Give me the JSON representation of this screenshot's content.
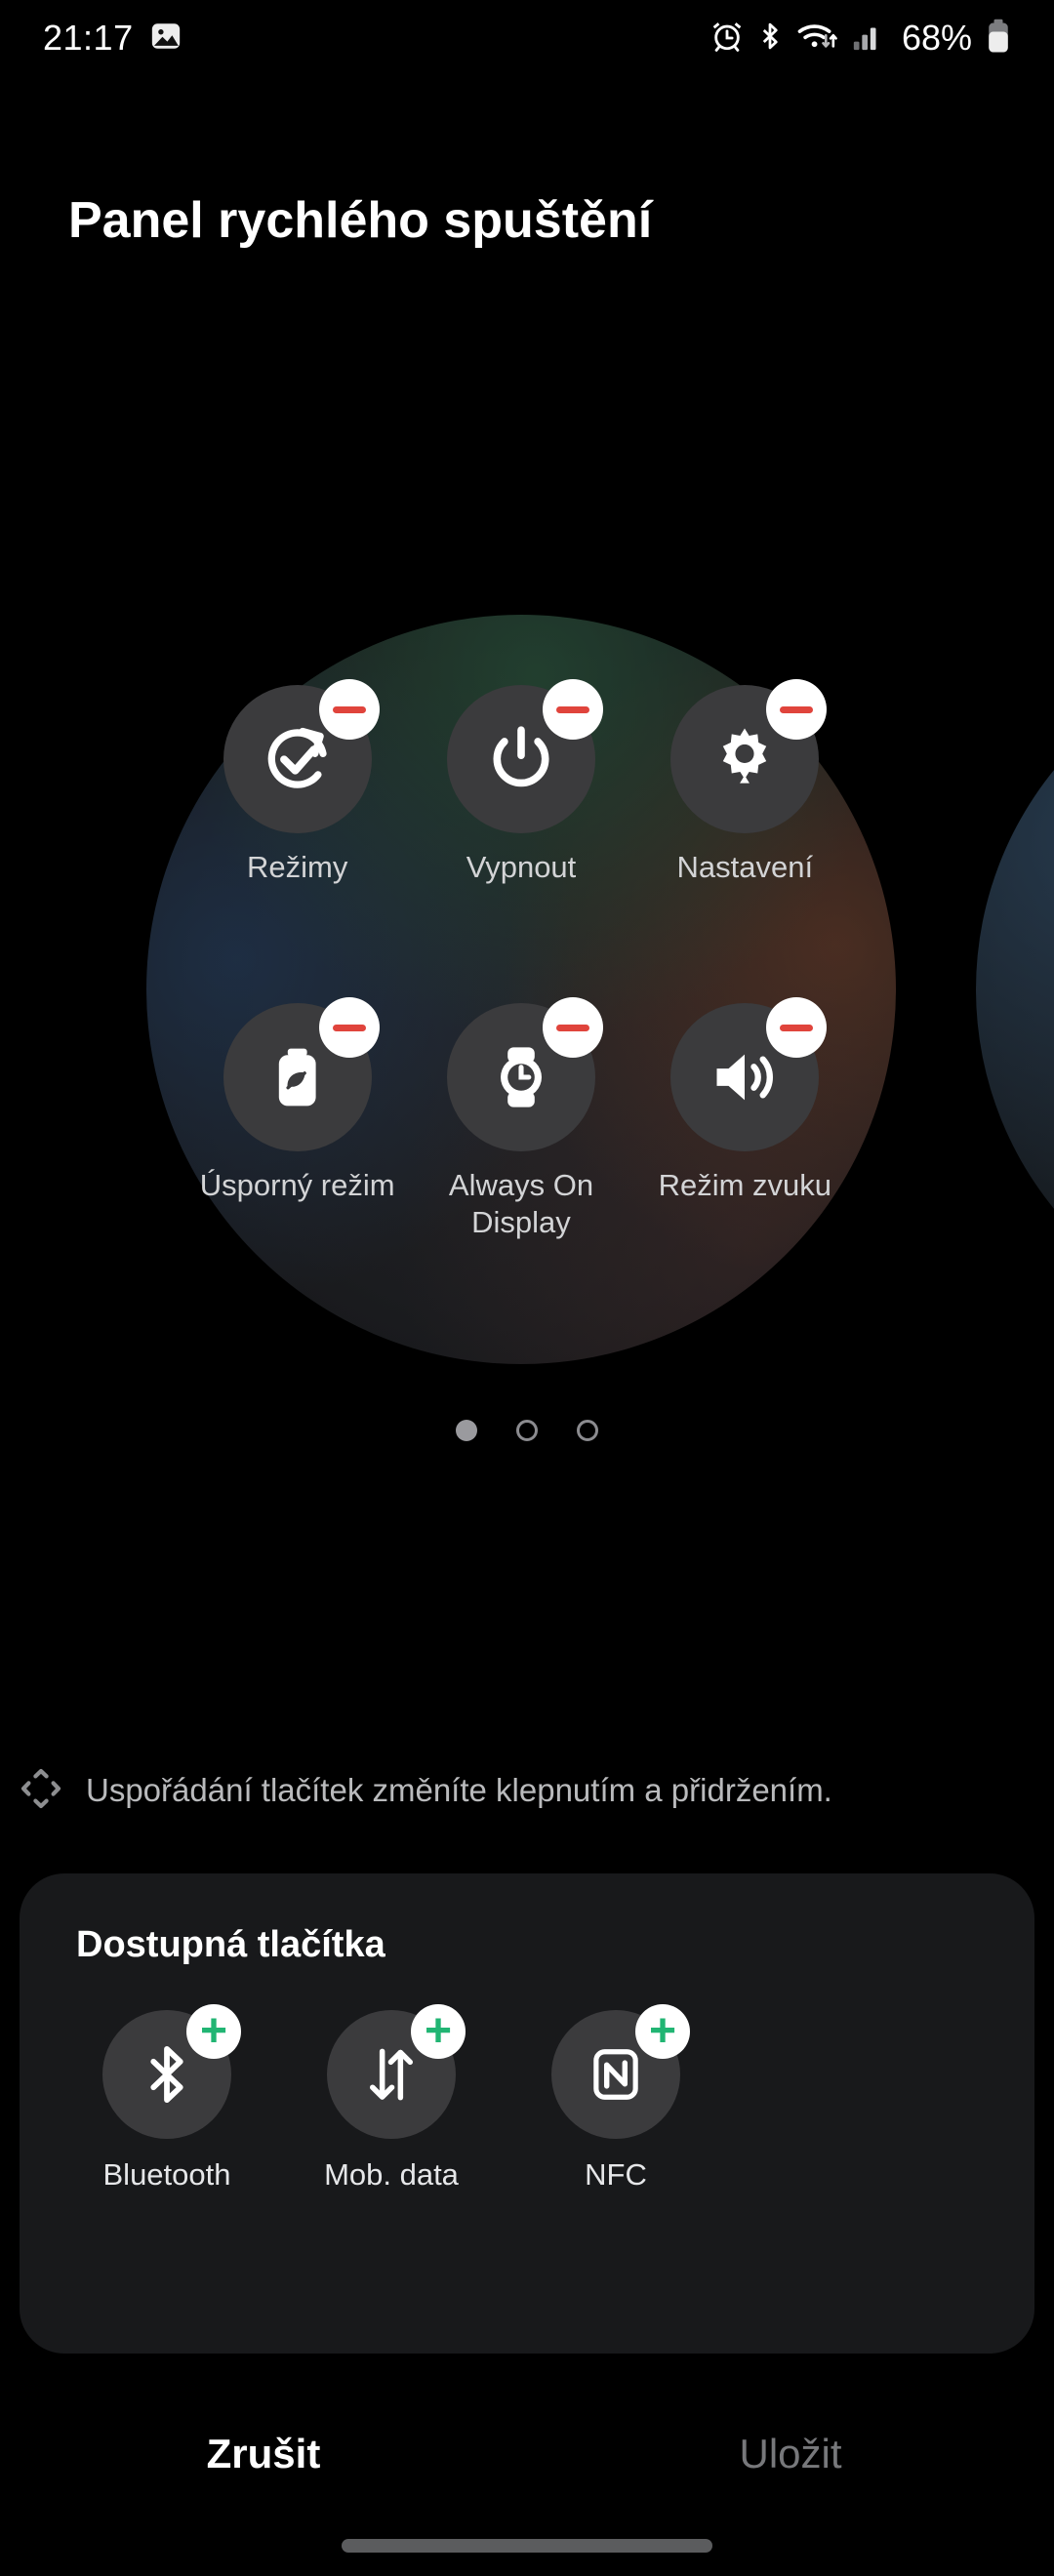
{
  "status_bar": {
    "time": "21:17",
    "left_icons": [
      "gallery-image-icon"
    ],
    "right_icons": [
      "alarm-icon",
      "bluetooth-icon",
      "wifi-icon",
      "signal-icon"
    ],
    "battery_percent": "68%"
  },
  "header": {
    "title": "Panel rychlého spuštění"
  },
  "panel": {
    "page_dots": {
      "count": 3,
      "active_index": 0
    },
    "tiles": [
      {
        "label": "Režimy",
        "icon": "modes-icon",
        "badge": "minus"
      },
      {
        "label": "Vypnout",
        "icon": "power-icon",
        "badge": "minus"
      },
      {
        "label": "Nastavení",
        "icon": "gear-icon",
        "badge": "minus"
      },
      {
        "label": "Úsporný režim",
        "icon": "battery-leaf-icon",
        "badge": "minus"
      },
      {
        "label": "Always On Display",
        "icon": "watch-clock-icon",
        "badge": "minus"
      },
      {
        "label": "Režim zvuku",
        "icon": "speaker-icon",
        "badge": "minus"
      }
    ]
  },
  "hint": {
    "icon": "move-arrows-icon",
    "text": "Uspořádání tlačítek změníte klepnutím a přidržením."
  },
  "available": {
    "title": "Dostupná tlačítka",
    "items": [
      {
        "label": "Bluetooth",
        "icon": "bluetooth-icon",
        "badge": "plus"
      },
      {
        "label": "Mob. data",
        "icon": "mobile-data-icon",
        "badge": "plus"
      },
      {
        "label": "NFC",
        "icon": "nfc-icon",
        "badge": "plus"
      }
    ]
  },
  "footer": {
    "cancel_label": "Zrušit",
    "save_label": "Uložit"
  },
  "colors": {
    "background": "#000000",
    "card": "#18191b",
    "tile": "#3b3b3d",
    "badge_remove": "#e0443c",
    "badge_add": "#21b573",
    "text_primary": "#ffffff",
    "text_secondary": "#b9babc",
    "text_disabled": "#77787b"
  }
}
